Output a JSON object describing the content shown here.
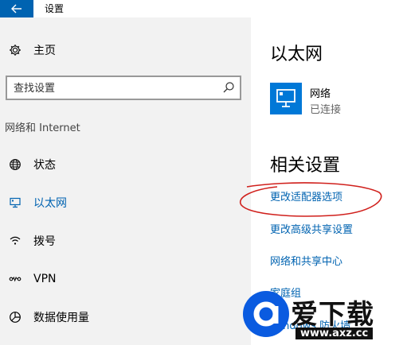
{
  "window": {
    "title": "设置"
  },
  "sidebar": {
    "home_label": "主页",
    "search_placeholder": "查找设置",
    "section_title": "网络和 Internet",
    "items": [
      {
        "label": "状态",
        "icon": "globe-icon"
      },
      {
        "label": "以太网",
        "icon": "ethernet-icon",
        "active": true
      },
      {
        "label": "拨号",
        "icon": "dialup-icon"
      },
      {
        "label": "VPN",
        "icon": "vpn-icon"
      },
      {
        "label": "数据使用量",
        "icon": "data-usage-icon"
      }
    ]
  },
  "main": {
    "heading": "以太网",
    "network": {
      "name": "网络",
      "status": "已连接"
    },
    "related_heading": "相关设置",
    "links": [
      "更改适配器选项",
      "更改高级共享设置",
      "网络和共享中心",
      "家庭组",
      "Windows 防火墙"
    ]
  },
  "watermark": {
    "brand": "爱下载",
    "url": "www.axz.cc"
  },
  "colors": {
    "accent": "#0063b1",
    "tile": "#0078d7",
    "sidebar_bg": "#f2f2f2",
    "annotation": "#d0201c"
  }
}
